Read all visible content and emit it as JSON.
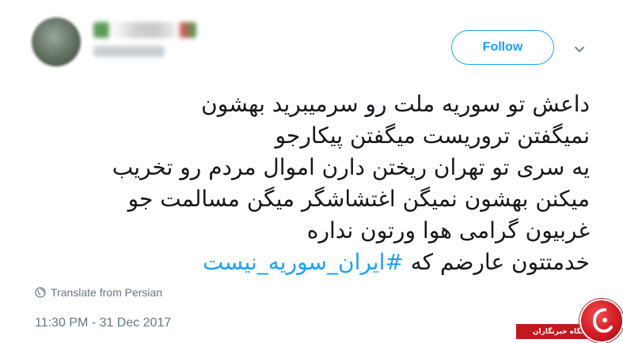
{
  "header": {
    "follow_label": "Follow",
    "caret_icon": "chevron-down-icon"
  },
  "tweet": {
    "lines": [
      "داعش تو سوریه ملت رو سرمیبرید بهشون",
      "نمیگفتن تروریست میگفتن پیکارجو",
      "یه سری تو تهران ریختن دارن اموال مردم رو تخریب",
      "میکنن بهشون نمیگن اغتشاشگر میگن مسالمت جو",
      "غربیون گرامی هوا ورتون نداره"
    ],
    "last_line_text": "خدمتتون عارضم که ",
    "hashtag": "#ایران_سوریه_نیست"
  },
  "footer": {
    "translate_label": "Translate from Persian",
    "translate_icon": "globe-icon",
    "timestamp": "11:30 PM - 31 Dec 2017"
  },
  "watermark": {
    "text": "باشگاه خبرنگاران"
  },
  "colors": {
    "accent": "#1da1f2",
    "text": "#14171a",
    "muted": "#657786",
    "watermark_red": "#c2181f"
  }
}
